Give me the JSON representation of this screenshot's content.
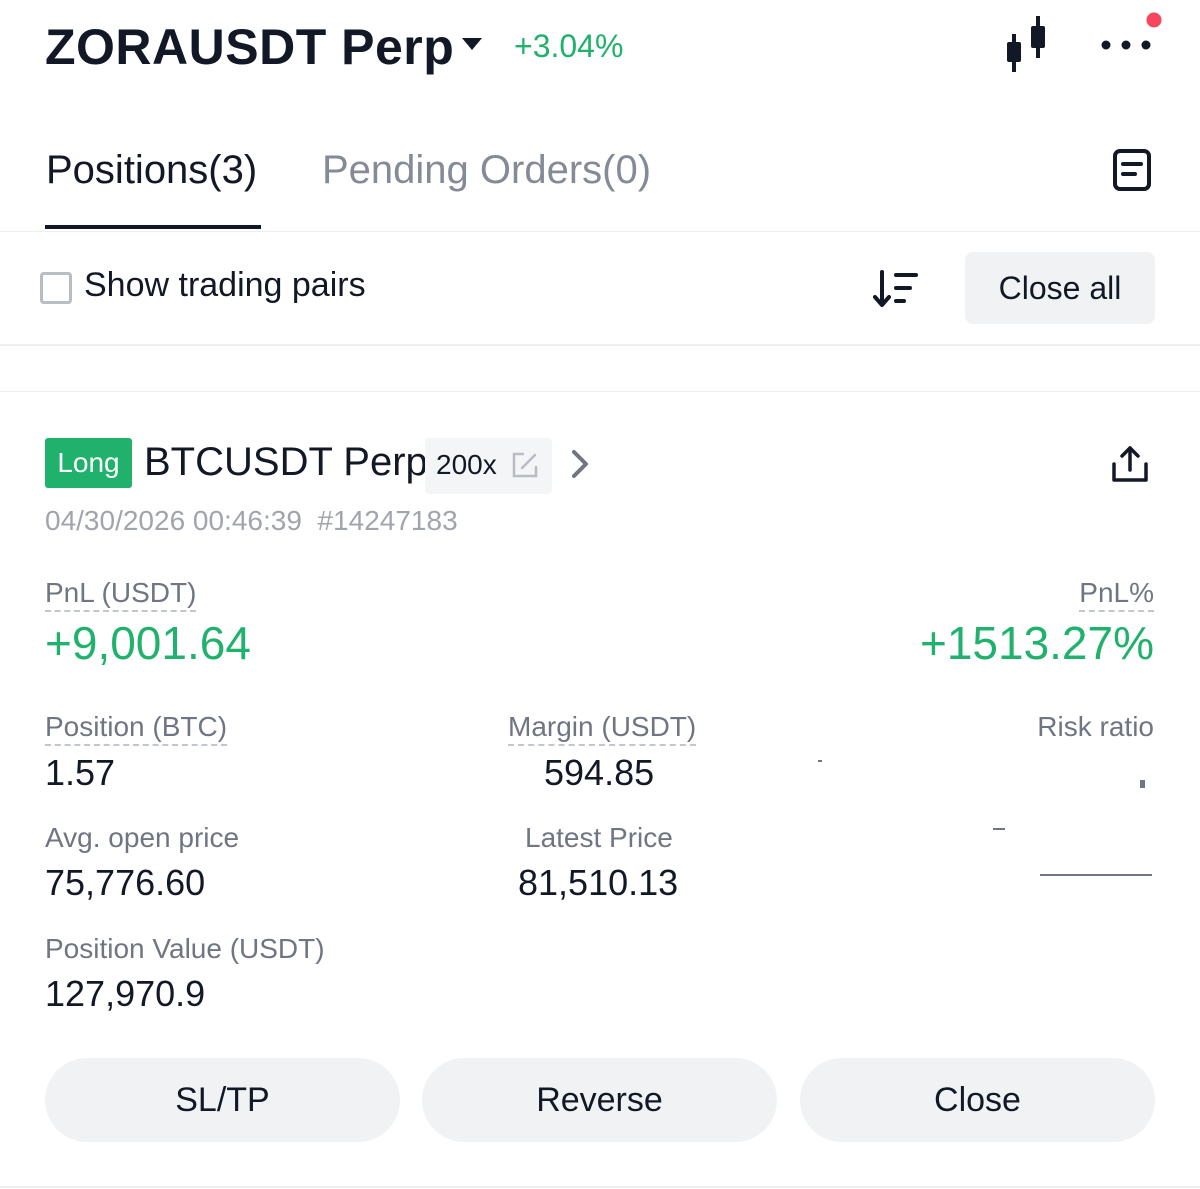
{
  "header": {
    "symbol": "ZORAUSDT Perp",
    "change_pct": "+3.04%",
    "icons": {
      "chart": "candlestick-icon",
      "more": "more-dots-icon"
    },
    "notification_dot_color": "#f6465d"
  },
  "tabs": [
    {
      "label": "Positions(3)",
      "active": true
    },
    {
      "label": "Pending Orders(0)",
      "active": false
    }
  ],
  "toolbar": {
    "show_pairs_label": "Show trading pairs",
    "show_pairs_checked": false,
    "close_all_label": "Close all",
    "icons": {
      "sort": "sort-icon",
      "notes": "notes-icon"
    }
  },
  "position": {
    "side": "Long",
    "pair": "BTCUSDT Perp",
    "leverage": "200x",
    "timestamp": "04/30/2026 00:46:39",
    "order_id": "#14247183",
    "pnl_label": "PnL (USDT)",
    "pnl_value": "+9,001.64",
    "pnl_pct_label": "PnL%",
    "pnl_pct_value": "+1513.27%",
    "size_label": "Position (BTC)",
    "size_value": "1.57",
    "margin_label": "Margin (USDT)",
    "margin_value": "594.85",
    "risk_label": "Risk ratio",
    "avg_open_label": "Avg. open price",
    "avg_open_value": "75,776.60",
    "latest_label": "Latest Price",
    "latest_value": "81,510.13",
    "value_label": "Position Value (USDT)",
    "value_value": "127,970.9",
    "actions": {
      "sltp": "SL/TP",
      "reverse": "Reverse",
      "close": "Close"
    }
  },
  "colors": {
    "positive": "#20b26c",
    "text": "#121826",
    "muted": "#6f7582",
    "button_bg": "#f0f2f4"
  }
}
